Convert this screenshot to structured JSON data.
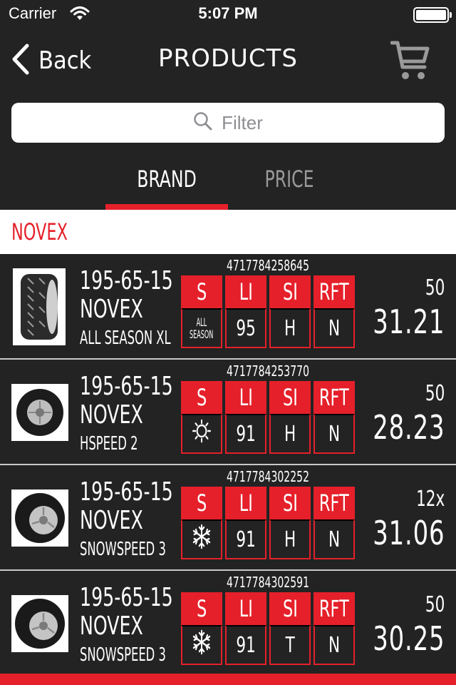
{
  "status": {
    "carrier": "Carrier",
    "time": "5:07 PM"
  },
  "nav": {
    "back_label": "Back",
    "title": "PRODUCTS"
  },
  "search": {
    "placeholder": "Filter"
  },
  "tabs": [
    {
      "label": "BRAND",
      "active": true
    },
    {
      "label": "PRICE",
      "active": false
    }
  ],
  "section": {
    "label": "NOVEX"
  },
  "columns": {
    "season": "S",
    "load_index": "LI",
    "speed_index": "SI",
    "runflat": "RFT"
  },
  "products": [
    {
      "ean": "4717784258645",
      "size": "195-65-15",
      "brand": "NOVEX",
      "model": "ALL SEASON XL",
      "season_lines": [
        "ALL",
        "SEASON"
      ],
      "season_icon": "all-season",
      "li": "95",
      "si": "H",
      "rft": "N",
      "qty": "50",
      "price": "31.21"
    },
    {
      "ean": "4717784253770",
      "size": "195-65-15",
      "brand": "NOVEX",
      "model": "HSPEED 2",
      "season_icon": "sun-icon",
      "li": "91",
      "si": "H",
      "rft": "N",
      "qty": "50",
      "price": "28.23"
    },
    {
      "ean": "4717784302252",
      "size": "195-65-15",
      "brand": "NOVEX",
      "model": "SNOWSPEED 3",
      "season_icon": "snowflake-icon",
      "li": "91",
      "si": "H",
      "rft": "N",
      "qty": "12x",
      "price": "31.06"
    },
    {
      "ean": "4717784302591",
      "size": "195-65-15",
      "brand": "NOVEX",
      "model": "SNOWSPEED 3",
      "season_icon": "snowflake-icon",
      "li": "91",
      "si": "T",
      "rft": "N",
      "qty": "50",
      "price": "30.25"
    }
  ],
  "colors": {
    "accent": "#e5202a",
    "background": "#232323"
  }
}
